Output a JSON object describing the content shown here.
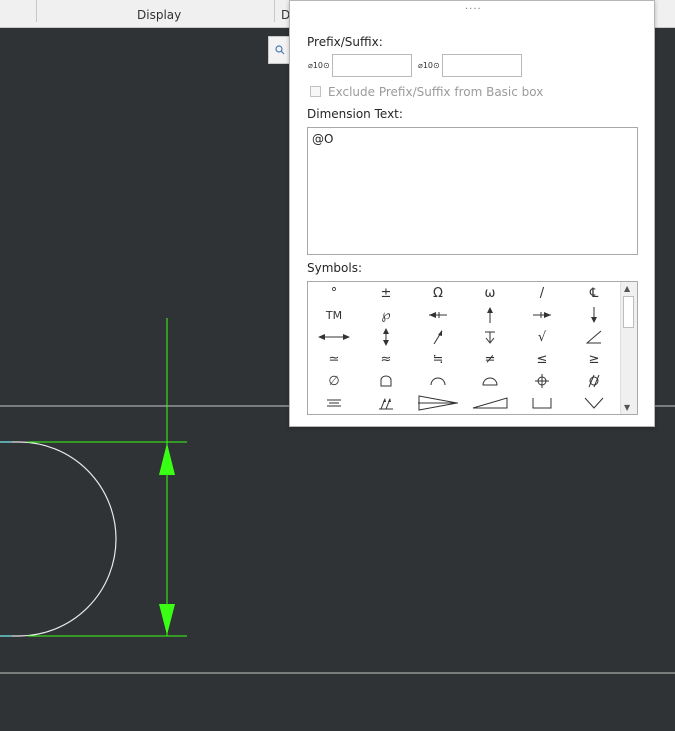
{
  "ribbon": {
    "group_display_label": "Display",
    "group_partial_label": "D"
  },
  "panel": {
    "prefix_suffix_label": "Prefix/Suffix:",
    "prefix_symbol": "⌀10⊙",
    "suffix_symbol": "⌀10⊙",
    "prefix_value": "",
    "suffix_value": "",
    "exclude_label": "Exclude Prefix/Suffix from Basic box",
    "exclude_checked": false,
    "dimension_text_label": "Dimension Text:",
    "dimension_text_value": "@O",
    "symbols_label": "Symbols:",
    "symbols": [
      "°",
      "±",
      "Ω",
      "ω",
      "/",
      "℄",
      "TM",
      "℘",
      "arrow-left-tick-icon",
      "arrow-up-icon",
      "arrow-right-tick-icon",
      "arrow-down-icon",
      "double-arrow-horizontal-icon",
      "double-arrow-vertical-icon",
      "arrow-diagonal-icon",
      "depth-arrow-icon",
      "√",
      "angle-icon",
      "≃",
      "≈",
      "≒",
      "≠",
      "≤",
      "≥",
      "∅",
      "profile-surface-icon",
      "profile-line-icon",
      "profile-half-icon",
      "position-icon",
      "cylindricity-icon",
      "flatness-icon",
      "total-runout-icon",
      "cone-icon",
      "slope-icon",
      "counterbore-icon",
      "countersink-icon"
    ]
  },
  "colors": {
    "canvas_bg": "#2f3335",
    "dimension_green": "#39ff14",
    "geometry_white": "#e8e8e8",
    "edge_line": "#c8c8c8"
  }
}
